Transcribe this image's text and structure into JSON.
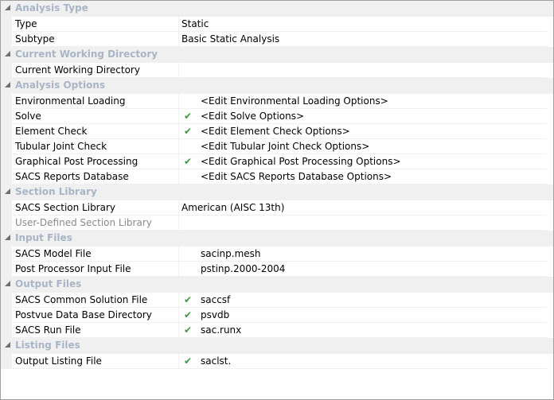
{
  "colors": {
    "category_text": "#a9b5c7",
    "category_bg": "#f0f0f0",
    "check": "#3a9a3a",
    "disabled_text": "#8a8a8a"
  },
  "rows": [
    {
      "kind": "category",
      "label": "Analysis Type"
    },
    {
      "kind": "property",
      "name": "Type",
      "value": "Static",
      "plain": true
    },
    {
      "kind": "property",
      "name": "Subtype",
      "value": "Basic Static Analysis",
      "plain": true
    },
    {
      "kind": "category",
      "label": "Current Working Directory"
    },
    {
      "kind": "property",
      "name": "Current Working Directory",
      "value": "",
      "plain": true
    },
    {
      "kind": "category",
      "label": "Analysis Options"
    },
    {
      "kind": "property",
      "name": "Environmental Loading",
      "value": "<Edit Environmental Loading Options>",
      "checked": false
    },
    {
      "kind": "property",
      "name": "Solve",
      "value": "<Edit Solve Options>",
      "checked": true
    },
    {
      "kind": "property",
      "name": "Element Check",
      "value": "<Edit Element Check Options>",
      "checked": true
    },
    {
      "kind": "property",
      "name": "Tubular Joint Check",
      "value": "<Edit Tubular Joint Check Options>",
      "checked": false
    },
    {
      "kind": "property",
      "name": "Graphical Post Processing",
      "value": "<Edit Graphical Post Processing Options>",
      "checked": true
    },
    {
      "kind": "property",
      "name": "SACS Reports Database",
      "value": "<Edit SACS Reports Database Options>",
      "checked": false
    },
    {
      "kind": "category",
      "label": "Section Library"
    },
    {
      "kind": "property",
      "name": "SACS Section Library",
      "value": "American (AISC 13th)",
      "plain": true
    },
    {
      "kind": "property",
      "name": "User-Defined Section Library",
      "value": "",
      "plain": true,
      "disabled": true
    },
    {
      "kind": "category",
      "label": "Input Files"
    },
    {
      "kind": "property",
      "name": "SACS Model File",
      "value": "sacinp.mesh",
      "checked": false
    },
    {
      "kind": "property",
      "name": "Post Processor Input File",
      "value": "pstinp.2000-2004",
      "checked": false
    },
    {
      "kind": "category",
      "label": "Output Files"
    },
    {
      "kind": "property",
      "name": "SACS Common Solution File",
      "value": "saccsf",
      "checked": true
    },
    {
      "kind": "property",
      "name": "Postvue Data Base Directory",
      "value": "psvdb",
      "checked": true
    },
    {
      "kind": "property",
      "name": "SACS Run File",
      "value": "sac.runx",
      "checked": true
    },
    {
      "kind": "category",
      "label": "Listing Files"
    },
    {
      "kind": "property",
      "name": "Output Listing File",
      "value": "saclst.",
      "checked": true
    }
  ],
  "check_glyph": "✔"
}
